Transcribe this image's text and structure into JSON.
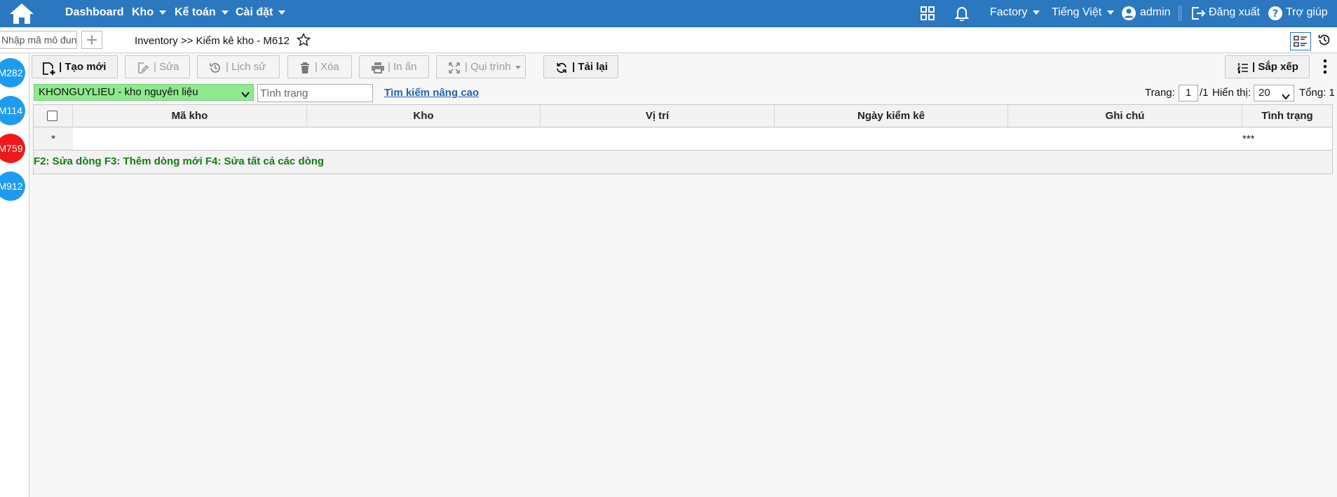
{
  "nav": {
    "items": [
      {
        "label": "Dashboard",
        "has_dropdown": false
      },
      {
        "label": "Kho",
        "has_dropdown": true
      },
      {
        "label": "Kế toán",
        "has_dropdown": true
      },
      {
        "label": "Cài đặt",
        "has_dropdown": true
      }
    ],
    "factory": "Factory",
    "language": "Tiếng Việt",
    "user": "admin",
    "logout": "Đăng xuất",
    "help": "Trợ giúp",
    "icons": [
      "home-icon",
      "grid-apps-icon",
      "bell-icon",
      "user-circle-icon",
      "logout-icon",
      "help-icon"
    ]
  },
  "module_bar": {
    "module_placeholder": "Nhập mã mô đun",
    "breadcrumb": "Inventory >> Kiểm kê kho - M612"
  },
  "sidebar": {
    "modules": [
      {
        "code": "M282",
        "color": "#1e9bf0"
      },
      {
        "code": "M114",
        "color": "#1e9bf0"
      },
      {
        "code": "M759",
        "color": "#f01818"
      },
      {
        "code": "M912",
        "color": "#1e9bf0"
      }
    ]
  },
  "toolbar": {
    "create": "| Tạo mới",
    "edit": "| Sửa",
    "history": "| Lịch sử",
    "delete": "| Xóa",
    "print": "| In ấn",
    "process": "| Qui trình",
    "reload": "| Tải lại",
    "sort": "| Sắp xếp"
  },
  "filters": {
    "warehouse": "KHONGUYLIEU - kho nguyên liệu",
    "status_placeholder": "Tình trạng",
    "advanced_search": "Tìm kiếm nâng cao"
  },
  "pager": {
    "page_label": "Trang:",
    "page": "1",
    "total_pages": "/1",
    "show_label": "Hiển thị:",
    "page_size": "20",
    "total_label": "Tổng: 1"
  },
  "grid": {
    "columns": [
      "Mã kho",
      "Kho",
      "Vị trí",
      "Ngày kiểm kê",
      "Ghi chú",
      "Tình trạng"
    ],
    "new_row_marker": "*",
    "new_row_status": "***",
    "hint": "F2: Sửa dòng F3: Thêm dòng mới F4: Sửa tất cả các dòng"
  },
  "colors": {
    "nav_bg": "#2b78c0",
    "warehouse_bg": "#8fe88f",
    "hint": "#157a15",
    "link": "#1f63b1"
  }
}
